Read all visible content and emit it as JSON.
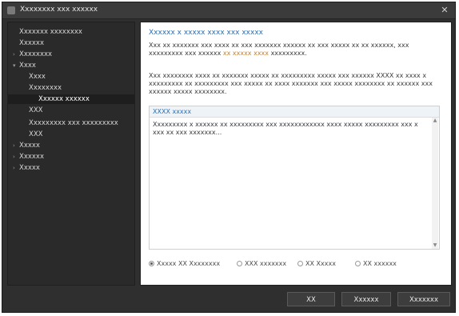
{
  "window": {
    "title": "Xxxxxxxx xxx xxxxxx",
    "close_glyph": "✕"
  },
  "sidebar": {
    "items": [
      {
        "label": "Xxxxxxx xxxxxxxx",
        "expander": "",
        "indent": 0
      },
      {
        "label": "Xxxxxx",
        "expander": "",
        "indent": 0
      },
      {
        "label": "Xxxxxxxx",
        "expander": "›",
        "indent": 0
      },
      {
        "label": "Xxxx",
        "expander": "▾",
        "indent": 0
      },
      {
        "label": "Xxxx",
        "expander": "",
        "indent": 1
      },
      {
        "label": "Xxxxxxxx",
        "expander": "",
        "indent": 1
      },
      {
        "label": "Xxxxxx xxxxxx",
        "expander": "",
        "indent": 2,
        "selected": true
      },
      {
        "label": "XXX",
        "expander": "",
        "indent": 1
      },
      {
        "label": "Xxxxxxxxx xxx xxxxxxxxx",
        "expander": "",
        "indent": 1
      },
      {
        "label": "XXX",
        "expander": "",
        "indent": 1
      },
      {
        "label": "Xxxxx",
        "expander": "›",
        "indent": 0
      },
      {
        "label": "Xxxxxx",
        "expander": "›",
        "indent": 0
      },
      {
        "label": "Xxxxx",
        "expander": "›",
        "indent": 0
      }
    ]
  },
  "content": {
    "title": "Xxxxxx x xxxxx xxxx xxx xxxxx",
    "para1_a": "Xxx xx xxxxxxx xxx xxxx xx xxx xxxxxxx xxxxxx xx xxx xxxxx xx xx xxxxxx, xxx xxxxxxxxx xxx xxxxxx ",
    "para1_link": "xx xxxxx xxxx",
    "para1_b": " xxxxxxxxx.",
    "para2": "Xxx xxxxxxxx xxxx xx xxxxxxx xxxxx xx xxxxxxxxx xxxxx xxx xxxxxx XXXX xx xxxx x xxxxxxxxx xx xxxxxxxxx xxx xxxxx xx xxxx xxxxxxx xxx xxxxx xxxxxxxx xx xxxxxx xxx xxxxxx xxxxx xxxxxxxx.",
    "editor": {
      "label": "XXXX xxxxx",
      "text": "Xxxxxxxxx x xxxxxx xx xxxxxxxxx xxx xxxxxxxxxxxx xxxx xxxxx xxxxxxxxx xxx x xxx xx xxx xxxxxxx..."
    },
    "radios": [
      {
        "label": "Xxxxx XX Xxxxxxxx",
        "checked": true
      },
      {
        "label": "XXX xxxxxxx",
        "checked": false
      },
      {
        "label": "XX Xxxxx",
        "checked": false
      },
      {
        "label": "XX xxxxxx",
        "checked": false
      }
    ]
  },
  "footer": {
    "ok_label": "XX",
    "cancel_label": "Xxxxxx",
    "apply_label": "Xxxxxxx"
  }
}
